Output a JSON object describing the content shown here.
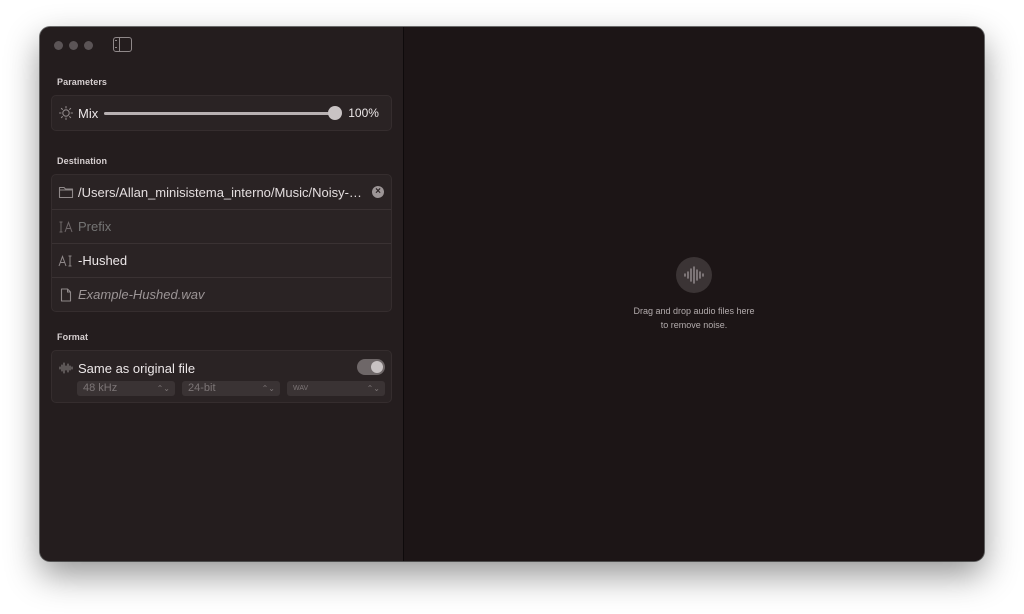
{
  "window": {
    "traffic_lights": [
      "close",
      "minimize",
      "zoom"
    ],
    "sidebar_toggle_icon": "sidebar-left-icon"
  },
  "parameters": {
    "section_title": "Parameters",
    "mix": {
      "icon": "sun-dotted-icon",
      "label": "Mix",
      "value_label": "100%",
      "value_percent": 100
    }
  },
  "destination": {
    "section_title": "Destination",
    "folder": {
      "icon": "folder-icon",
      "path": "/Users/Allan_minisistema_interno/Music/Noisy-a...",
      "clear_icon": "xmark-circle-icon"
    },
    "prefix": {
      "icon": "text-cursor-prefix-icon",
      "placeholder": "Prefix"
    },
    "suffix": {
      "icon": "text-cursor-suffix-icon",
      "value": "-Hushed"
    },
    "example": {
      "icon": "document-icon",
      "filename": "Example-Hushed.wav"
    }
  },
  "format": {
    "section_title": "Format",
    "same_as_original": {
      "icon": "waveform-icon",
      "label": "Same as original file",
      "enabled": true
    },
    "sample_rate": "48 kHz",
    "bit_depth": "24-bit",
    "file_type": "WAV"
  },
  "drop_zone": {
    "icon": "waveform-circle-icon",
    "line1": "Drag and drop audio files here",
    "line2": "to remove noise."
  },
  "colors": {
    "window_bg": "#1c1516",
    "sidebar_bg": "#241d1e",
    "group_bg": "#2a2324"
  }
}
